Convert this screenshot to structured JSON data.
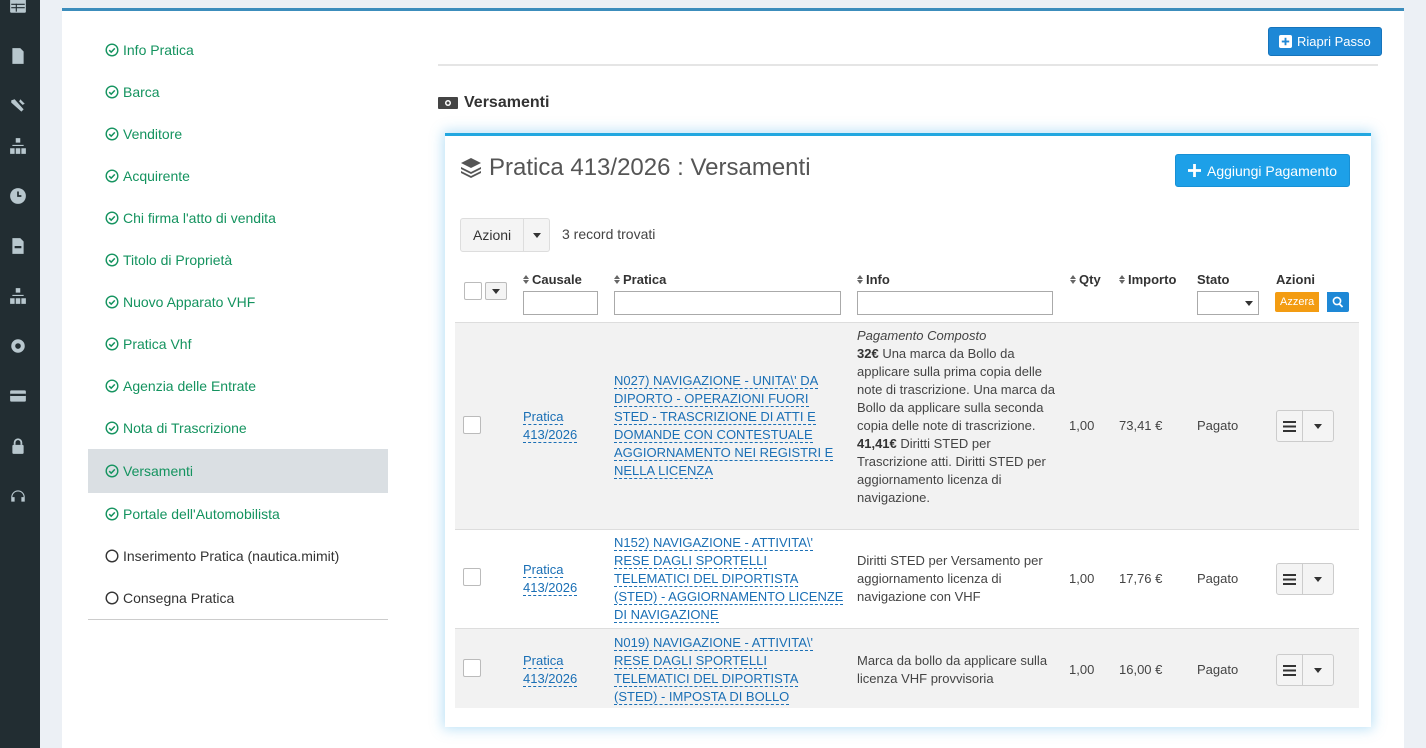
{
  "sidebar": {
    "icons": [
      "table-icon",
      "file-icon",
      "tools-icon",
      "sitemap-icon",
      "clock-icon",
      "pdf-file-icon",
      "sitemap-icon",
      "gear-icon",
      "credit-card-icon",
      "lock-icon",
      "headset-icon"
    ]
  },
  "steps": [
    {
      "label": "Info Pratica",
      "status": "done"
    },
    {
      "label": "Barca",
      "status": "done"
    },
    {
      "label": "Venditore",
      "status": "done"
    },
    {
      "label": "Acquirente",
      "status": "done"
    },
    {
      "label": "Chi firma l'atto di vendita",
      "status": "done"
    },
    {
      "label": "Titolo di Proprietà",
      "status": "done"
    },
    {
      "label": "Nuovo Apparato VHF",
      "status": "done"
    },
    {
      "label": "Pratica Vhf",
      "status": "done"
    },
    {
      "label": "Agenzia delle Entrate",
      "status": "done"
    },
    {
      "label": "Nota di Trascrizione",
      "status": "done"
    },
    {
      "label": "Versamenti",
      "status": "active"
    },
    {
      "label": "Portale dell'Automobilista",
      "status": "done"
    },
    {
      "label": "Inserimento Pratica (nautica.mimit)",
      "status": "pending"
    },
    {
      "label": "Consegna Pratica",
      "status": "pending"
    }
  ],
  "toolbar": {
    "reopen_label": "Riapri Passo"
  },
  "section": {
    "title": "Versamenti"
  },
  "box": {
    "title": "Pratica 413/2026 : Versamenti",
    "add_label": "Aggiungi Pagamento",
    "actions_label": "Azioni",
    "records": "3 record trovati"
  },
  "table": {
    "headers": {
      "causale": "Causale",
      "pratica": "Pratica",
      "info": "Info",
      "qty": "Qty",
      "importo": "Importo",
      "stato": "Stato",
      "azioni": "Azioni"
    },
    "reset_label": "Azzera",
    "rows": [
      {
        "causale": "Pratica 413/2026",
        "pratica": "N027) NAVIGAZIONE - UNITA\\' DA DIPORTO - OPERAZIONI FUORI STED - TRASCRIZIONE DI ATTI E DOMANDE CON CONTESTUALE AGGIORNAMENTO NEI REGISTRI E NELLA LICENZA",
        "info_title": "Pagamento Composto",
        "info_amount1": "32€",
        "info_text1": " Una marca da Bollo da applicare sulla prima copia delle note di trascrizione. Una marca da Bollo da applicare sulla seconda copia delle note di trascrizione.",
        "info_amount2": "41,41€",
        "info_text2": " Diritti STED per Trascrizione atti. Diritti STED per aggiornamento licenza di navigazione.",
        "qty": "1,00",
        "importo": "73,41 €",
        "stato": "Pagato"
      },
      {
        "causale": "Pratica 413/2026",
        "pratica": "N152) NAVIGAZIONE - ATTIVITA\\' RESE DAGLI SPORTELLI TELEMATICI DEL DIPORTISTA (STED) - AGGIORNAMENTO LICENZE DI NAVIGAZIONE",
        "info": "Diritti STED per Versamento per aggiornamento licenza di navigazione con VHF",
        "qty": "1,00",
        "importo": "17,76 €",
        "stato": "Pagato"
      },
      {
        "causale": "Pratica 413/2026",
        "pratica": "N019) NAVIGAZIONE - ATTIVITA\\' RESE DAGLI SPORTELLI TELEMATICI DEL DIPORTISTA (STED) - IMPOSTA DI BOLLO",
        "info": "Marca da bollo da applicare sulla licenza VHF provvisoria",
        "qty": "1,00",
        "importo": "16,00 €",
        "stato": "Pagato"
      }
    ]
  },
  "colors": {
    "accent": "#1e88d6",
    "success": "#14935f",
    "warning": "#f39c12",
    "sidebar_bg": "#222d32"
  }
}
